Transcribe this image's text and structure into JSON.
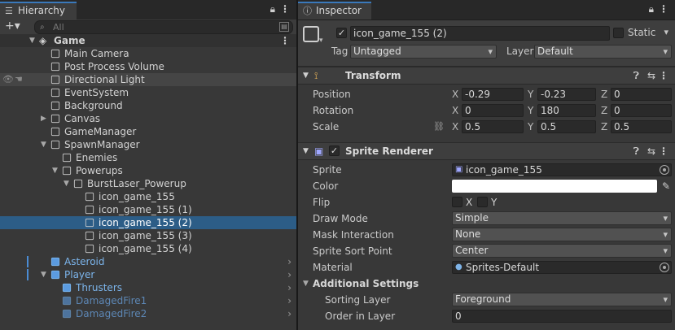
{
  "hierarchy": {
    "tab_label": "Hierarchy",
    "search_placeholder": "All",
    "add_label": "+▾",
    "rows": [
      {
        "label": "Game",
        "icon": "unity-scene-icon",
        "arrow": "▼"
      },
      {
        "label": "Main Camera",
        "icon": "gameobject-icon"
      },
      {
        "label": "Post Process Volume",
        "icon": "gameobject-icon"
      },
      {
        "label": "Directional Light",
        "icon": "gameobject-icon"
      },
      {
        "label": "EventSystem",
        "icon": "gameobject-icon"
      },
      {
        "label": "Background",
        "icon": "gameobject-icon"
      },
      {
        "label": "Canvas",
        "icon": "gameobject-icon",
        "arrow": "▶"
      },
      {
        "label": "GameManager",
        "icon": "gameobject-icon"
      },
      {
        "label": "SpawnManager",
        "icon": "gameobject-icon",
        "arrow": "▼"
      },
      {
        "label": "Enemies",
        "icon": "gameobject-icon"
      },
      {
        "label": "Powerups",
        "icon": "gameobject-icon",
        "arrow": "▼"
      },
      {
        "label": "BurstLaser_Powerup",
        "icon": "gameobject-icon",
        "arrow": "▼"
      },
      {
        "label": "icon_game_155",
        "icon": "gameobject-icon"
      },
      {
        "label": "icon_game_155 (1)",
        "icon": "gameobject-icon"
      },
      {
        "label": "icon_game_155 (2)",
        "icon": "gameobject-icon"
      },
      {
        "label": "icon_game_155 (3)",
        "icon": "gameobject-icon"
      },
      {
        "label": "icon_game_155 (4)",
        "icon": "gameobject-icon"
      },
      {
        "label": "Asteroid",
        "icon": "prefab-icon"
      },
      {
        "label": "Player",
        "icon": "prefab-icon",
        "arrow": "▼"
      },
      {
        "label": "Thrusters",
        "icon": "prefab-icon"
      },
      {
        "label": "DamagedFire1",
        "icon": "prefab-icon"
      },
      {
        "label": "DamagedFire2",
        "icon": "prefab-icon"
      }
    ]
  },
  "inspector": {
    "tab_label": "Inspector",
    "object_name": "icon_game_155 (2)",
    "active_check": "✓",
    "static_label": "Static",
    "tag_label": "Tag",
    "tag_value": "Untagged",
    "layer_label": "Layer",
    "layer_value": "Default",
    "transform": {
      "title": "Transform",
      "position_label": "Position",
      "rotation_label": "Rotation",
      "scale_label": "Scale",
      "position": {
        "x": "-0.29",
        "y": "-0.23",
        "z": "0"
      },
      "rotation": {
        "x": "0",
        "y": "180",
        "z": "0"
      },
      "scale": {
        "x": "0.5",
        "y": "0.5",
        "z": "0.5"
      },
      "x_label": "X",
      "y_label": "Y",
      "z_label": "Z"
    },
    "sprite_renderer": {
      "title": "Sprite Renderer",
      "enabled_check": "✓",
      "sprite_label": "Sprite",
      "sprite_value": "icon_game_155",
      "color_label": "Color",
      "color_value": "#ffffff",
      "flip_label": "Flip",
      "flip_x": "X",
      "flip_y": "Y",
      "draw_mode_label": "Draw Mode",
      "draw_mode_value": "Simple",
      "mask_label": "Mask Interaction",
      "mask_value": "None",
      "sort_point_label": "Sprite Sort Point",
      "sort_point_value": "Center",
      "material_label": "Material",
      "material_value": "Sprites-Default",
      "additional_label": "Additional Settings",
      "sorting_layer_label": "Sorting Layer",
      "sorting_layer_value": "Foreground",
      "order_label": "Order in Layer",
      "order_value": "0"
    }
  },
  "colors": {
    "accent": "#3a79bb",
    "selection": "#2c5d87",
    "prefab": "#7cb5ec"
  }
}
